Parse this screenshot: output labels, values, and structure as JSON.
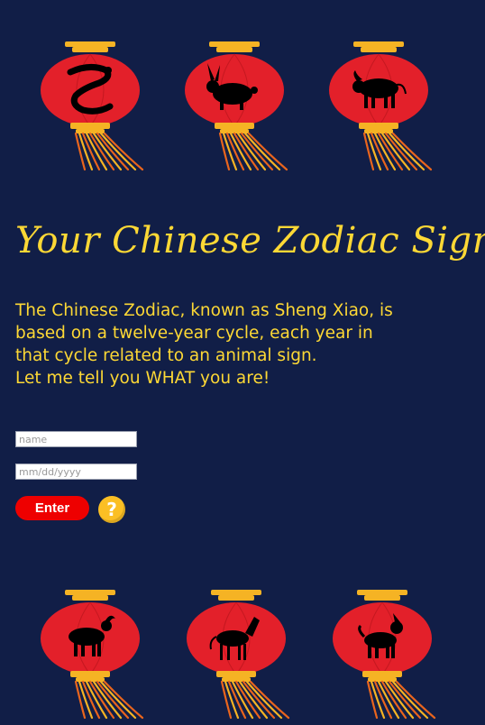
{
  "colors": {
    "background": "#111e47",
    "accent_yellow": "#fdd835",
    "lantern_red": "#e3202a",
    "lantern_gold": "#f5b324",
    "enter_red": "#ee0000",
    "help_yellow": "#fbbf24"
  },
  "lanterns_top": [
    {
      "icon": "snake-icon"
    },
    {
      "icon": "rabbit-icon"
    },
    {
      "icon": "ox-icon"
    }
  ],
  "lanterns_bottom": [
    {
      "icon": "goat-icon"
    },
    {
      "icon": "horse-icon"
    },
    {
      "icon": "dog-icon"
    }
  ],
  "title": "Your Chinese Zodiac Sign",
  "intro": {
    "line1": "The Chinese Zodiac, known as Sheng Xiao, is based on a twelve-year cycle, each year in that cycle related to an animal sign.",
    "line2": "Let me tell you WHAT you are!"
  },
  "form": {
    "name_placeholder": "name",
    "date_placeholder": "mm/dd/yyyy",
    "enter_label": "Enter",
    "help_label": "?"
  }
}
